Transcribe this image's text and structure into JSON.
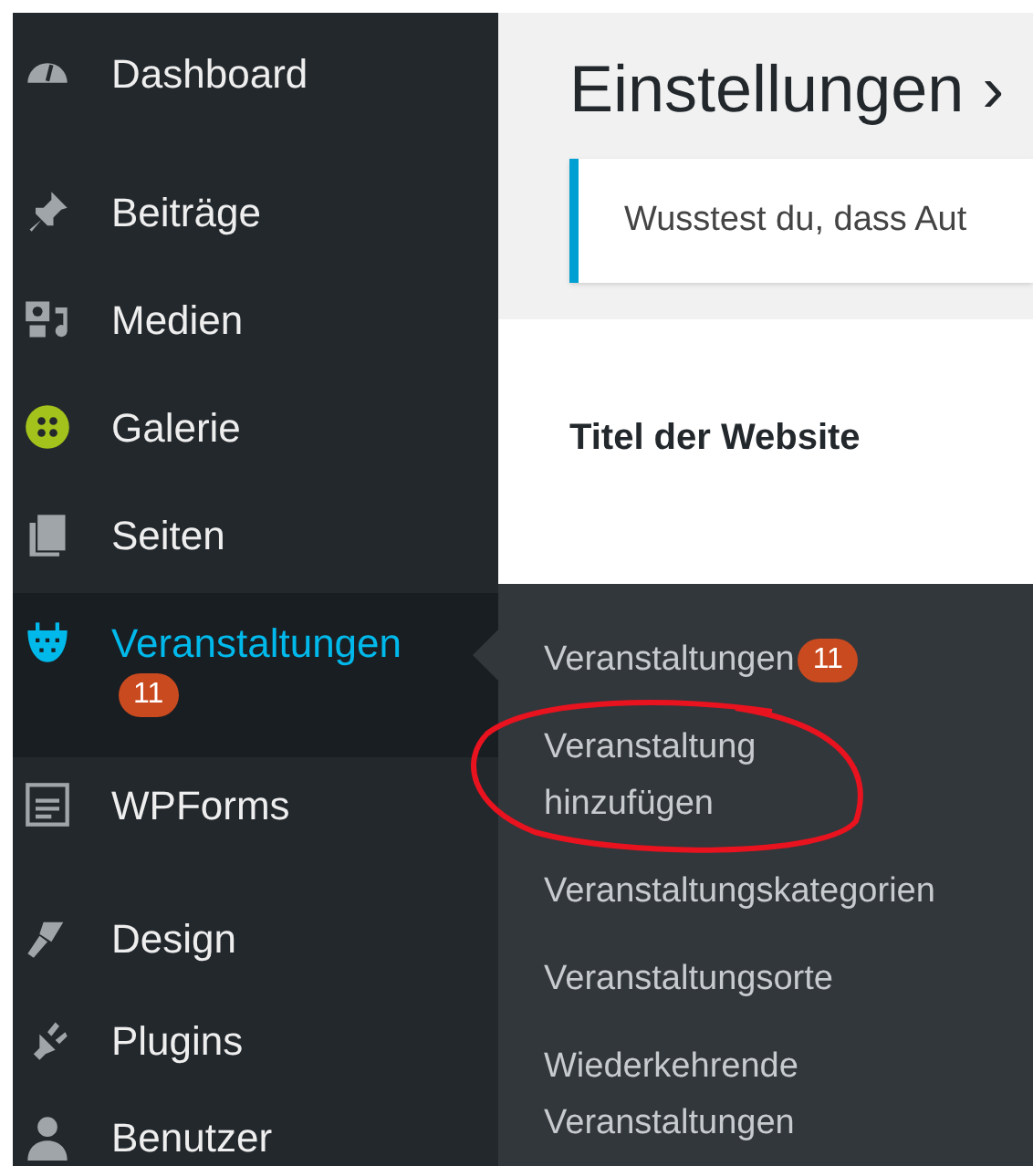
{
  "menu": [
    {
      "label": "Dashboard",
      "selected": false
    },
    {
      "label": "Beiträge",
      "selected": false
    },
    {
      "label": "Medien",
      "selected": false
    },
    {
      "label": "Galerie",
      "selected": false
    },
    {
      "label": "Seiten",
      "selected": false
    },
    {
      "label": "Veranstaltungen",
      "selected": true,
      "badge": "11"
    },
    {
      "label": "WPForms",
      "selected": false
    },
    {
      "label": "Design",
      "selected": false
    },
    {
      "label": "Plugins",
      "selected": false
    },
    {
      "label": "Benutzer",
      "selected": false
    }
  ],
  "page": {
    "title": "Einstellungen ›",
    "notice": "Wusstest du, dass Aut",
    "field_label": "Titel der Website"
  },
  "submenu": [
    {
      "label": "Veranstaltungen",
      "badge": "11",
      "highlighted": false
    },
    {
      "label": "Veranstaltung hinzufügen",
      "highlighted": true
    },
    {
      "label": "Veranstaltungskategorien",
      "highlighted": false
    },
    {
      "label": "Veranstaltungsorte",
      "highlighted": false
    },
    {
      "label": "Wiederkehrende Veranstaltungen",
      "highlighted": false
    }
  ]
}
